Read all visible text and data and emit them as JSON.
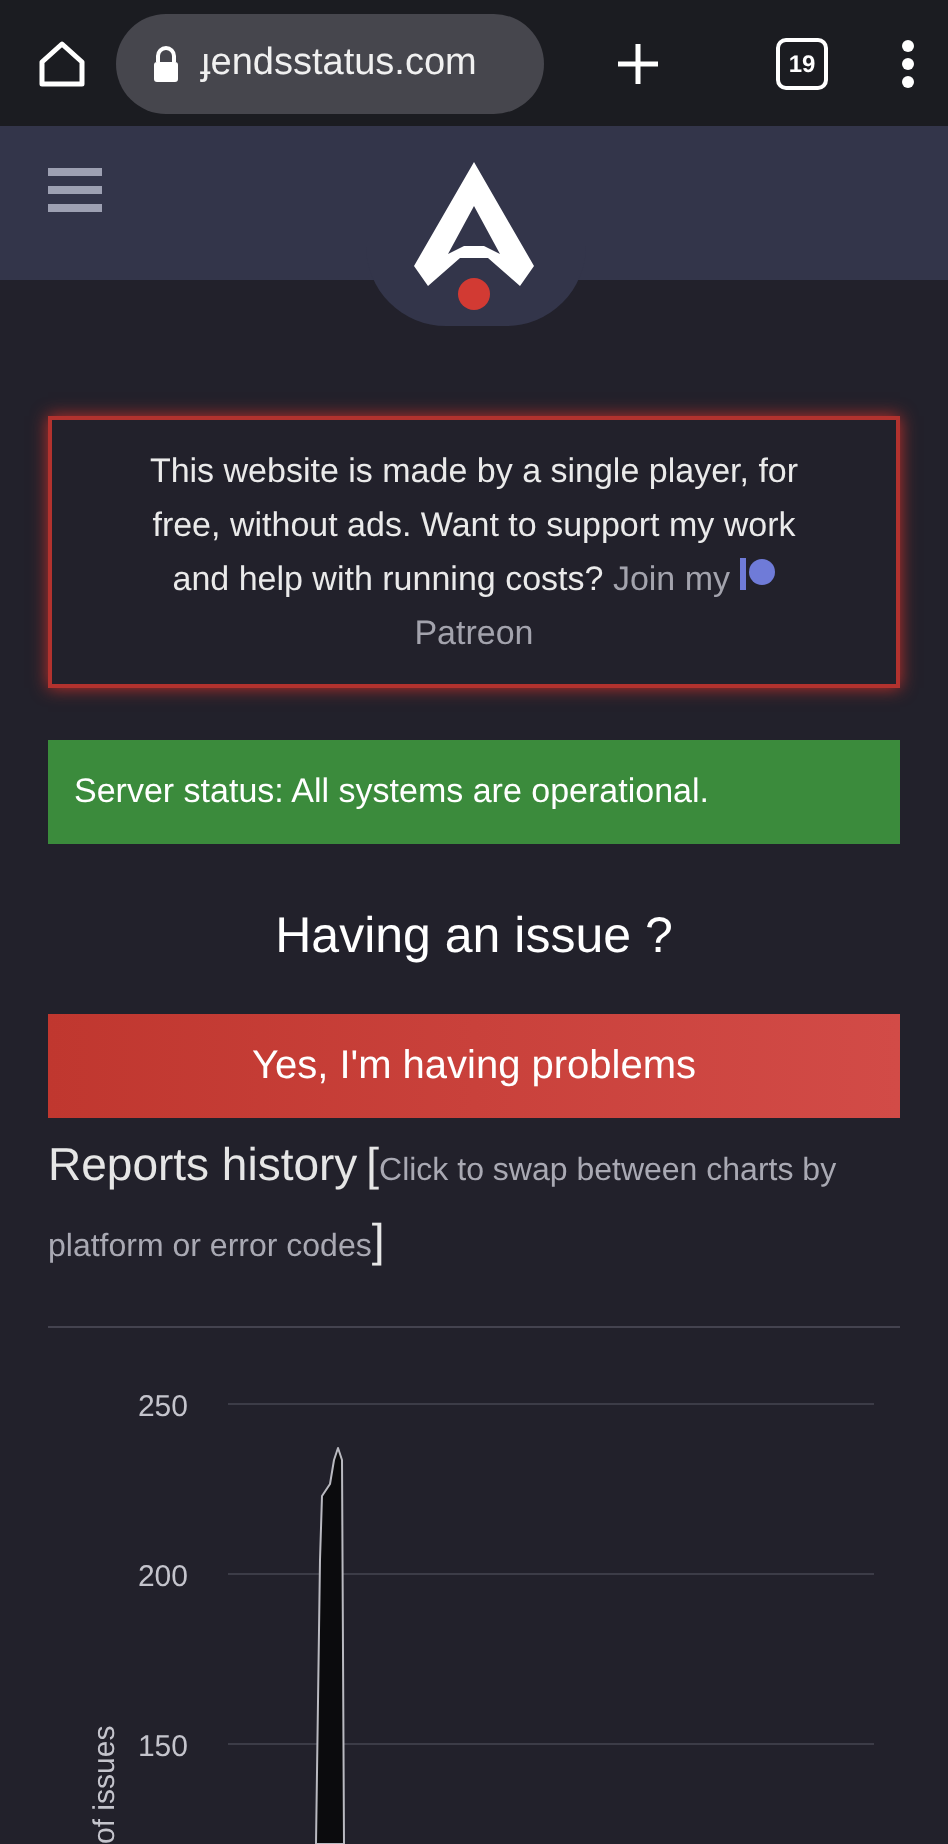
{
  "browser": {
    "url": "ɟendsstatus.com",
    "tab_count": "19"
  },
  "notice": {
    "text": "This website is made by a single player, for free, without ads. Want to support my work and help with running costs?",
    "link": "Join my",
    "link2": "Patreon"
  },
  "status": {
    "text": "Server status: All systems are operational.",
    "color": "#3b8b3c"
  },
  "issue": {
    "heading": "Having an issue ?",
    "button": "Yes, I'm having problems"
  },
  "reports": {
    "title": "Reports history",
    "bracket_open": "[",
    "hint": "Click to swap between charts by platform or error codes",
    "bracket_close": "]"
  },
  "chart": {
    "y_axis_title": "of issues",
    "y_ticks": [
      "250",
      "200",
      "150"
    ]
  }
}
